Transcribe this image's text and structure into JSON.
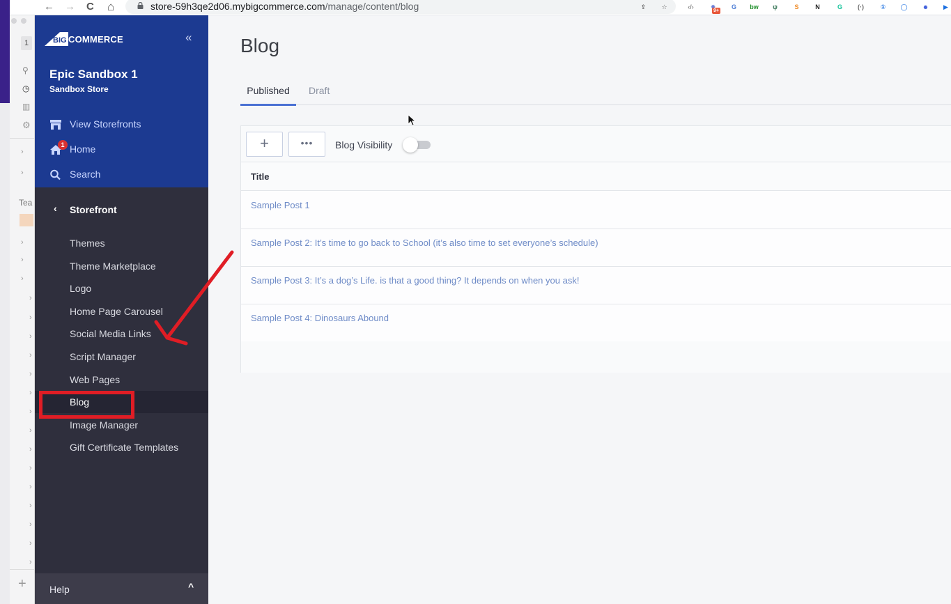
{
  "browser": {
    "url_domain": "store-59h3qe2d06.mybigcommerce.com",
    "url_path": "/manage/content/blog",
    "nav": {
      "back": "←",
      "forward": "→",
      "reload": "C",
      "home": "⌂"
    },
    "extensions": [
      {
        "name": "share-icon",
        "glyph": "⇪",
        "color": "#555555"
      },
      {
        "name": "bookmark-star-icon",
        "glyph": "☆",
        "color": "#555555"
      },
      {
        "name": "devtools-extension-icon",
        "glyph": "‹/›",
        "color": "#888888"
      },
      {
        "name": "gear-extension-icon",
        "glyph": "✹",
        "color": "#6a7fd8",
        "badge": "9+"
      },
      {
        "name": "translate-extension-icon",
        "glyph": "G",
        "color": "#4a7bd4"
      },
      {
        "name": "bw-extension-icon",
        "glyph": "bw",
        "color": "#1f8f2a"
      },
      {
        "name": "vue-extension-icon",
        "glyph": "ψ",
        "color": "#3d7a5c"
      },
      {
        "name": "s-extension-icon",
        "glyph": "S",
        "color": "#f08a24"
      },
      {
        "name": "notion-extension-icon",
        "glyph": "N",
        "color": "#222222"
      },
      {
        "name": "grammarly-extension-icon",
        "glyph": "G",
        "color": "#15c39a"
      },
      {
        "name": "circle-extension-icon",
        "glyph": "(·)",
        "color": "#666666"
      },
      {
        "name": "onepassword-extension-icon",
        "glyph": "①",
        "color": "#1a6fe0"
      },
      {
        "name": "chat-extension-icon",
        "glyph": "◯",
        "color": "#1a6fe0"
      },
      {
        "name": "bot-extension-icon",
        "glyph": "☻",
        "color": "#3b5bdb"
      },
      {
        "name": "play-extension-icon",
        "glyph": "▶",
        "color": "#1a6fe0"
      }
    ]
  },
  "background_app": {
    "badge_count": "1",
    "team_label": "Tea"
  },
  "sidebar": {
    "brand": "COMMERCE",
    "brand_prefix": "BIG",
    "collapse_glyph": "«",
    "store_name": "Epic Sandbox 1",
    "store_type": "Sandbox Store",
    "top_items": [
      {
        "label": "View Storefronts",
        "icon": "storefront-icon"
      },
      {
        "label": "Home",
        "icon": "home-icon",
        "badge": "1"
      },
      {
        "label": "Search",
        "icon": "search-icon"
      }
    ],
    "section": {
      "back_glyph": "‹",
      "title": "Storefront"
    },
    "sub_items": [
      {
        "label": "Themes"
      },
      {
        "label": "Theme Marketplace"
      },
      {
        "label": "Logo"
      },
      {
        "label": "Home Page Carousel"
      },
      {
        "label": "Social Media Links"
      },
      {
        "label": "Script Manager"
      },
      {
        "label": "Web Pages"
      },
      {
        "label": "Blog",
        "active": true
      },
      {
        "label": "Image Manager"
      },
      {
        "label": "Gift Certificate Templates"
      }
    ],
    "help": {
      "label": "Help",
      "caret": "^"
    }
  },
  "main": {
    "title": "Blog",
    "tabs": [
      {
        "label": "Published",
        "active": true
      },
      {
        "label": "Draft",
        "active": false
      }
    ],
    "toolbar": {
      "add_glyph": "+",
      "more_glyph": "•••",
      "visibility_label": "Blog Visibility",
      "visibility_on": false
    },
    "table": {
      "columns": [
        "Title"
      ],
      "rows": [
        {
          "title": "Sample Post 1"
        },
        {
          "title": "Sample Post 2: It’s time to go back to School (it’s also time to set everyone’s schedule)"
        },
        {
          "title": "Sample Post 3: It’s a dog’s Life. is that a good thing? It depends on when you ask!"
        },
        {
          "title": "Sample Post 4: Dinosaurs Abound"
        }
      ]
    }
  },
  "annotations": {
    "highlight_color": "#e01d25",
    "highlighted_item": "Blog"
  }
}
